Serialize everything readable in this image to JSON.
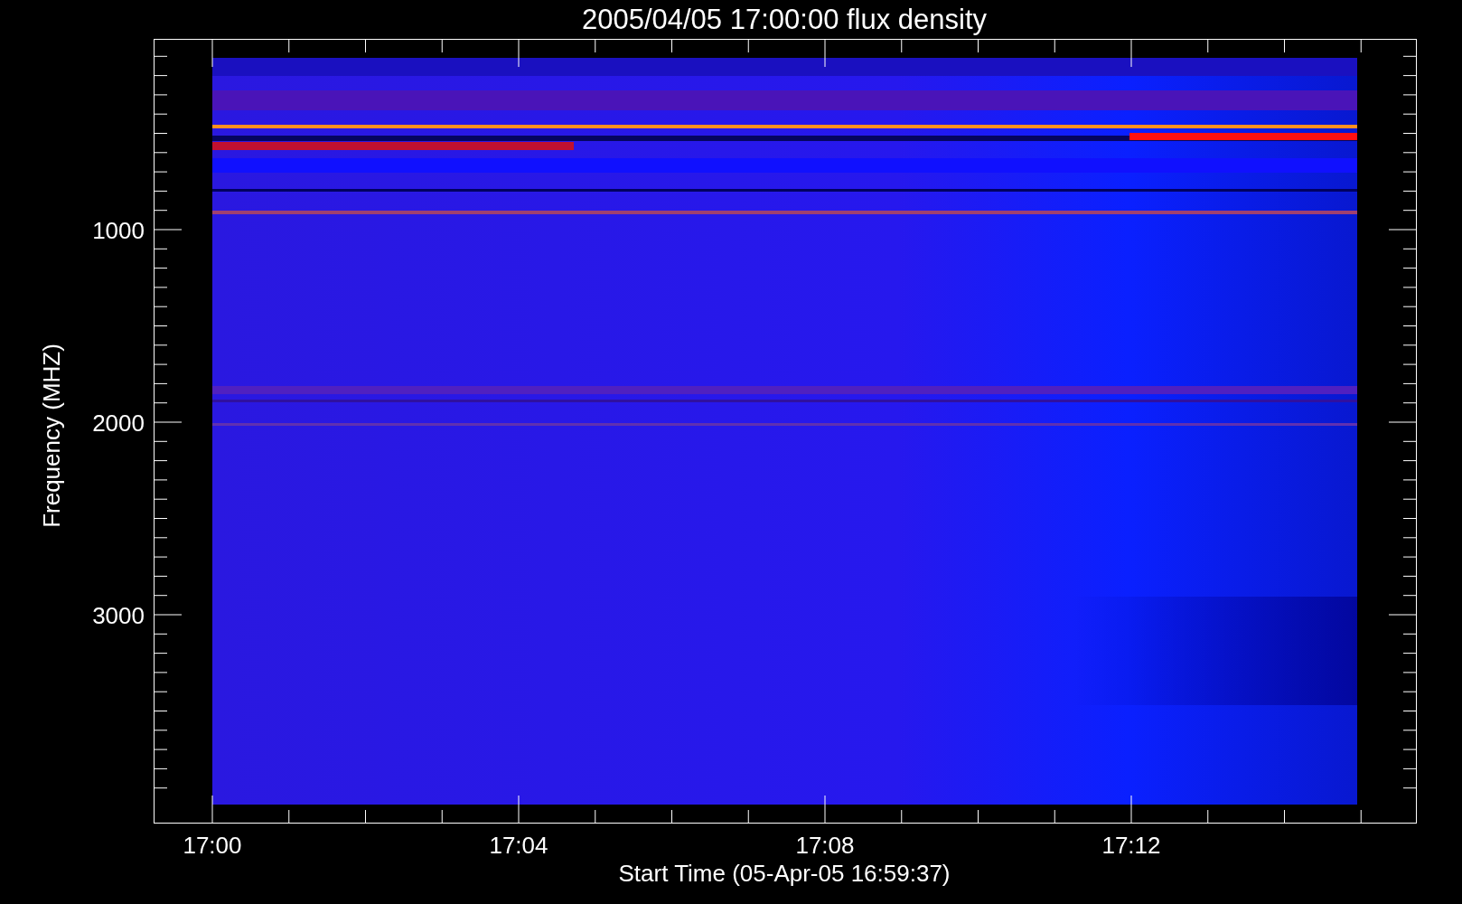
{
  "title": "2005/04/05 17:00:00 flux density",
  "y_axis": {
    "label": "Frequency (MHZ)",
    "ticks": [
      "1000",
      "2000",
      "3000"
    ]
  },
  "x_axis": {
    "label": "Start Time (05-Apr-05 16:59:37)",
    "ticks": [
      "17:00",
      "17:04",
      "17:08",
      "17:12"
    ]
  }
}
